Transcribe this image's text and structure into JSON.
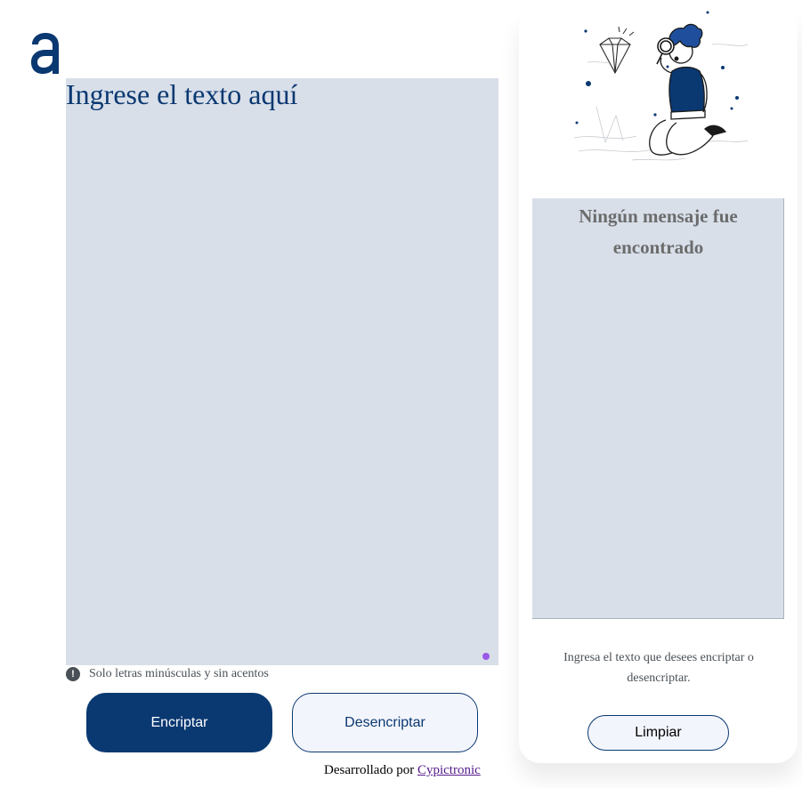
{
  "logo": {
    "icon": "alura-logo-icon",
    "color": "#0a3871"
  },
  "input": {
    "placeholder": "Ingrese el texto aquí"
  },
  "hint": {
    "icon": "exclamation-circle-icon",
    "text": "Solo letras minúsculas y sin acentos"
  },
  "buttons": {
    "encrypt": "Encriptar",
    "decrypt": "Desencriptar",
    "clear": "Limpiar"
  },
  "footer": {
    "prefix": "Desarrollado por ",
    "link_text": "Cypictronic"
  },
  "result": {
    "title_line1": "Ningún mensaje fue",
    "title_line2": "encontrado",
    "text_line1": "Ingresa el texto que desees encriptar o",
    "text_line2": "desencriptar."
  },
  "illustration": {
    "icon": "person-with-magnifying-glass-illustration"
  },
  "colors": {
    "primary": "#0a3871",
    "textarea_bg": "#d8dfe9",
    "button_light": "#f3f5fc",
    "muted_text": "#495057"
  }
}
